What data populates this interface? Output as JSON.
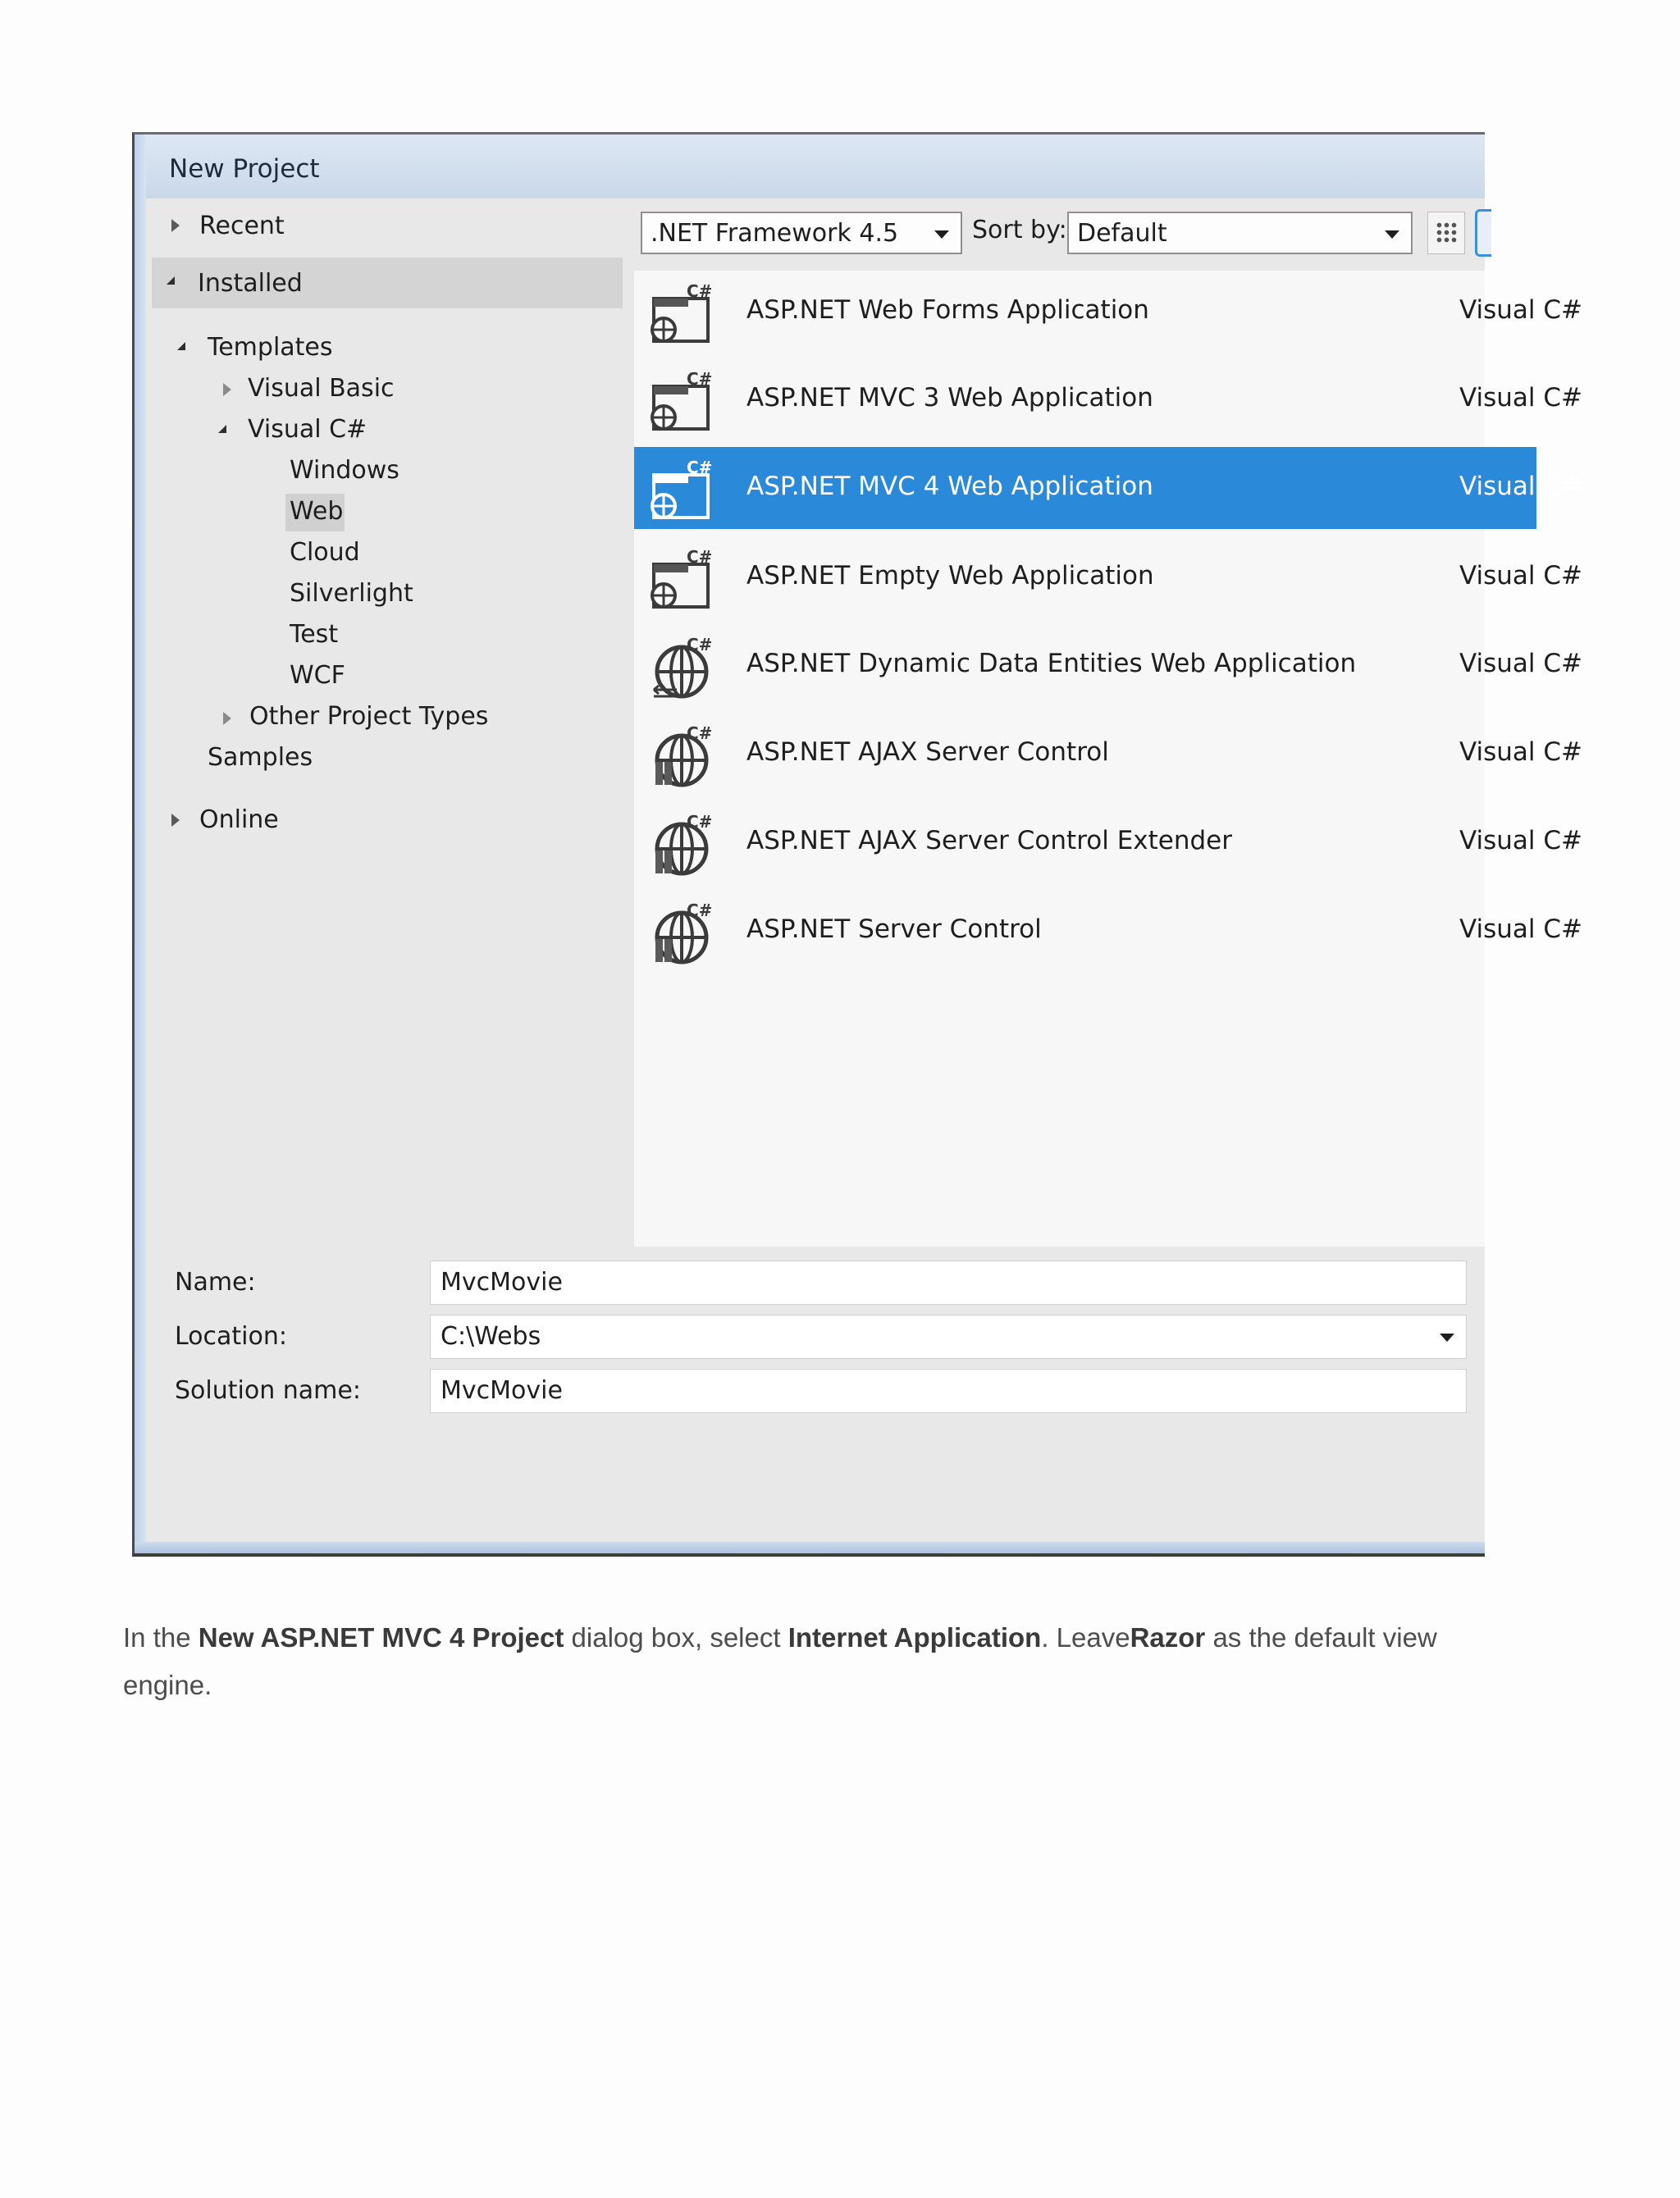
{
  "dialog": {
    "title": "New Project",
    "tree": {
      "recent": "Recent",
      "installed": "Installed",
      "templates": "Templates",
      "visual_basic": "Visual Basic",
      "visual_csharp": "Visual C#",
      "windows": "Windows",
      "web": "Web",
      "cloud": "Cloud",
      "silverlight": "Silverlight",
      "test": "Test",
      "wcf": "WCF",
      "other_project_types": "Other Project Types",
      "samples": "Samples",
      "online": "Online"
    },
    "toolbar": {
      "framework": ".NET Framework 4.5",
      "sort_by_label": "Sort by:",
      "sort_by_value": "Default"
    },
    "templates": [
      {
        "name": "ASP.NET Web Forms Application",
        "lang": "Visual C#",
        "icon": "web-forms-icon"
      },
      {
        "name": "ASP.NET MVC 3 Web Application",
        "lang": "Visual C#",
        "icon": "web-app-icon"
      },
      {
        "name": "ASP.NET MVC 4 Web Application",
        "lang": "Visual C#",
        "icon": "web-app-icon",
        "selected": true
      },
      {
        "name": "ASP.NET Empty Web Application",
        "lang": "Visual C#",
        "icon": "web-app-icon"
      },
      {
        "name": "ASP.NET Dynamic Data Entities Web Application",
        "lang": "Visual C#",
        "icon": "globe-icon"
      },
      {
        "name": "ASP.NET AJAX Server Control",
        "lang": "Visual C#",
        "icon": "server-control-icon"
      },
      {
        "name": "ASP.NET AJAX Server Control Extender",
        "lang": "Visual C#",
        "icon": "server-control-icon"
      },
      {
        "name": "ASP.NET Server Control",
        "lang": "Visual C#",
        "icon": "server-control-icon"
      }
    ],
    "form": {
      "name_label": "Name:",
      "name_value": "MvcMovie",
      "location_label": "Location:",
      "location_value": "C:\\Webs",
      "solution_label": "Solution name:",
      "solution_value": "MvcMovie"
    }
  },
  "caption": {
    "t1": "In the ",
    "b1": "New ASP.NET MVC 4 Project",
    "t2": " dialog box, select ",
    "b2": "Internet Application",
    "t3": ". Leave",
    "b3": "Razor",
    "t4": " as the default view engine."
  },
  "colors": {
    "selection": "#2b89d9",
    "titlebar": "#c9d8ea",
    "dialog_bg": "#e8e8e8"
  }
}
